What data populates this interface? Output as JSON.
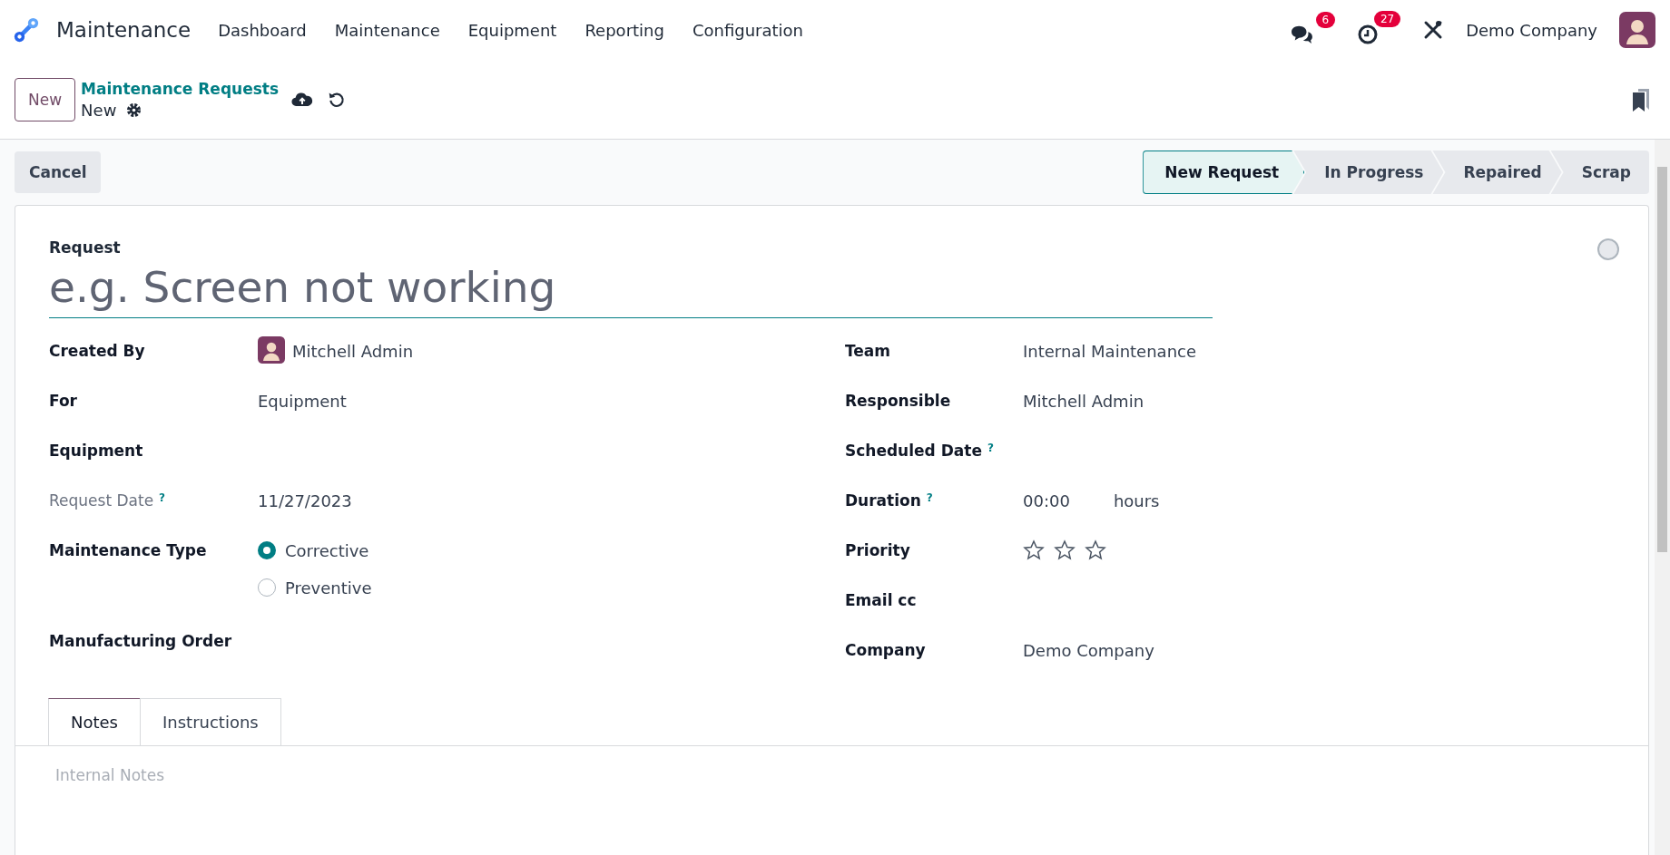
{
  "navbar": {
    "app_name": "Maintenance",
    "menu": [
      "Dashboard",
      "Maintenance",
      "Equipment",
      "Reporting",
      "Configuration"
    ],
    "messages_count": "6",
    "activities_count": "27",
    "company": "Demo Company"
  },
  "control_panel": {
    "new_button": "New",
    "breadcrumb": "Maintenance Requests",
    "record_title": "New"
  },
  "action_bar": {
    "cancel_button": "Cancel",
    "stages": [
      {
        "label": "New Request",
        "selected": true
      },
      {
        "label": "In Progress",
        "selected": false
      },
      {
        "label": "Repaired",
        "selected": false
      },
      {
        "label": "Scrap",
        "selected": false
      }
    ]
  },
  "form": {
    "request_label": "Request",
    "request_placeholder": "e.g. Screen not working",
    "left_fields": [
      {
        "label": "Created By",
        "kind": "user",
        "value": "Mitchell Admin",
        "readonly": false
      },
      {
        "label": "For",
        "kind": "text",
        "value": "Equipment",
        "readonly": false
      },
      {
        "label": "Equipment",
        "kind": "text",
        "readonly": false
      },
      {
        "label": "Request Date",
        "help": "?",
        "kind": "text",
        "value": "11/27/2023",
        "readonly": true
      },
      {
        "label": "Maintenance Type",
        "kind": "radio",
        "readonly": false,
        "options": [
          {
            "label": "Corrective",
            "selected": true
          },
          {
            "label": "Preventive",
            "selected": false
          }
        ]
      },
      {
        "label": "Manufacturing Order",
        "kind": "text",
        "readonly": false
      }
    ],
    "right_fields": [
      {
        "label": "Team",
        "kind": "text",
        "value": "Internal Maintenance"
      },
      {
        "label": "Responsible",
        "kind": "text",
        "value": "Mitchell Admin"
      },
      {
        "label": "Scheduled Date",
        "help": "?",
        "kind": "text"
      },
      {
        "label": "Duration",
        "help": "?",
        "kind": "duration",
        "value": "00:00",
        "unit": "hours"
      },
      {
        "label": "Priority",
        "kind": "stars",
        "stars": 0
      },
      {
        "label": "Email cc",
        "kind": "text"
      },
      {
        "label": "Company",
        "kind": "text",
        "value": "Demo Company"
      }
    ],
    "tabs": [
      {
        "label": "Notes",
        "selected": true
      },
      {
        "label": "Instructions",
        "selected": false
      }
    ],
    "notes_placeholder": "Internal Notes"
  }
}
